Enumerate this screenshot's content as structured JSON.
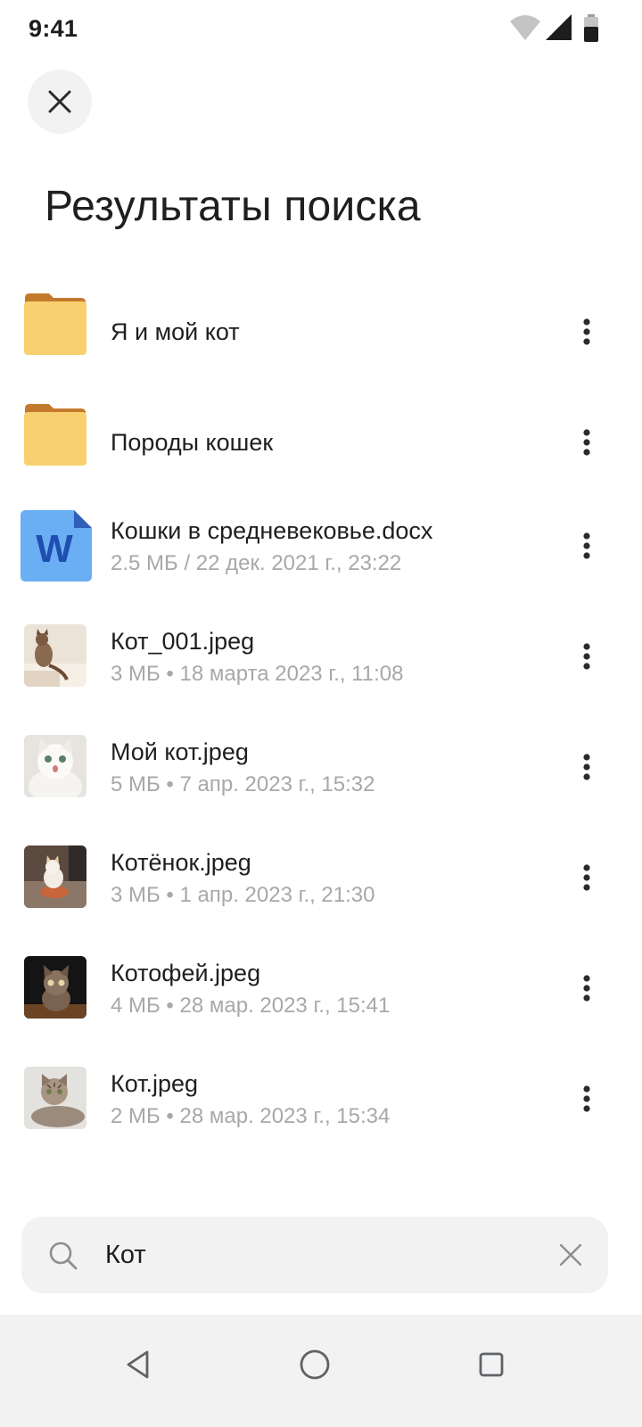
{
  "status_bar": {
    "time": "9:41",
    "icons": [
      "wifi-icon",
      "cellular-signal-icon",
      "battery-icon"
    ]
  },
  "header": {
    "close_icon": "close-icon",
    "title": "Результаты поиска"
  },
  "results": [
    {
      "type": "folder",
      "icon": "folder-icon",
      "name": "Я и мой кот",
      "meta": ""
    },
    {
      "type": "folder",
      "icon": "folder-icon",
      "name": "Породы кошек",
      "meta": ""
    },
    {
      "type": "document",
      "icon": "word-document-icon",
      "name": "Кошки в средневековье.docx",
      "meta": "2.5 МБ / 22 дек. 2021 г., 23:22"
    },
    {
      "type": "image",
      "icon": "cat-photo-thumbnail",
      "name": "Кот_001.jpeg",
      "meta": "3 МБ • 18 марта 2023 г., 11:08"
    },
    {
      "type": "image",
      "icon": "cat-photo-thumbnail",
      "name": "Мой кот.jpeg",
      "meta": "5 МБ • 7 апр. 2023 г., 15:32"
    },
    {
      "type": "image",
      "icon": "kitten-photo-thumbnail",
      "name": "Котёнок.jpeg",
      "meta": "3 МБ • 1 апр. 2023 г., 21:30"
    },
    {
      "type": "image",
      "icon": "kitten-photo-thumbnail",
      "name": "Котофей.jpeg",
      "meta": "4 МБ • 28 мар. 2023 г., 15:41"
    },
    {
      "type": "image",
      "icon": "cat-photo-thumbnail",
      "name": "Кот.jpeg",
      "meta": "2 МБ • 28 мар. 2023 г., 15:34"
    }
  ],
  "more_icon": "more-vertical-icon",
  "search": {
    "value": "Кот",
    "search_icon": "search-icon",
    "clear_icon": "clear-icon"
  },
  "nav": {
    "back_icon": "back-triangle-icon",
    "home_icon": "home-circle-icon",
    "recents_icon": "recents-square-icon"
  },
  "colors": {
    "folder": "#f9d070",
    "folder_tab": "#c47a2c",
    "word_doc": "#6aaef3",
    "word_letter": "#1f4fb0",
    "meta_text": "#a8a8a8",
    "surface": "#f2f2f2"
  }
}
